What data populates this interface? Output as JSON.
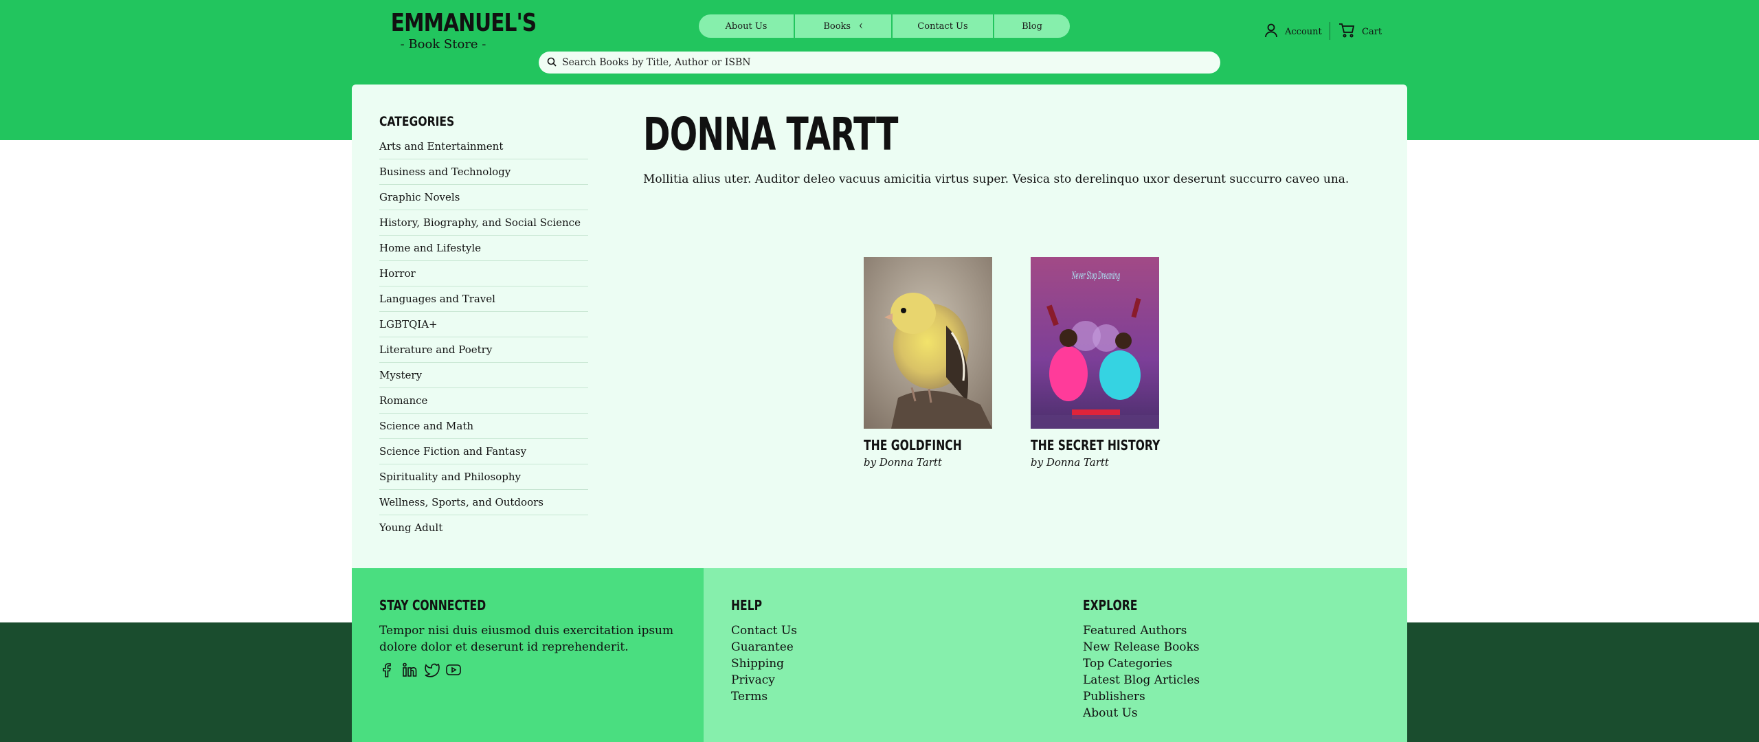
{
  "brand": {
    "name": "EMMANUEL'S",
    "tagline": "- Book Store -"
  },
  "nav": {
    "items": [
      {
        "label": "About Us"
      },
      {
        "label": "Books",
        "chevron": "chevron-left-icon"
      },
      {
        "label": "Contact Us"
      },
      {
        "label": "Blog"
      }
    ]
  },
  "header": {
    "account_label": "Account",
    "cart_label": "Cart"
  },
  "search": {
    "placeholder": "Search Books by Title, Author or ISBN"
  },
  "sidebar": {
    "title": "CATEGORIES",
    "items": [
      "Arts and Entertainment",
      "Business and Technology",
      "Graphic Novels",
      "History, Biography, and Social Science",
      "Home and Lifestyle",
      "Horror",
      "Languages and Travel",
      "LGBTQIA+",
      "Literature and Poetry",
      "Mystery",
      "Romance",
      "Science and Math",
      "Science Fiction and Fantasy",
      "Spirituality and Philosophy",
      "Wellness, Sports, and Outdoors",
      "Young Adult"
    ]
  },
  "author": {
    "name": "DONNA TARTT",
    "description": "Mollitia alius uter. Auditor deleo vacuus amicitia virtus super. Vesica sto derelinquo uxor deserunt succurro caveo una."
  },
  "books": [
    {
      "title": "THE GOLDFINCH",
      "byline": "by Donna Tartt",
      "cover": "goldfinch-bird-photo"
    },
    {
      "title": "THE SECRET HISTORY",
      "byline": "by Donna Tartt",
      "cover": "party-neon-sign-photo",
      "neon_text": "Never Stop Dreaming"
    }
  ],
  "footer": {
    "stay": {
      "title": "STAY CONNECTED",
      "text": "Tempor nisi duis eiusmod duis exercitation ipsum dolore dolor et deserunt id reprehenderit.",
      "social": [
        "facebook-icon",
        "linkedin-icon",
        "twitter-icon",
        "youtube-icon"
      ]
    },
    "help": {
      "title": "HELP",
      "links": [
        "Contact Us",
        "Guarantee",
        "Shipping",
        "Privacy",
        "Terms"
      ]
    },
    "explore": {
      "title": "EXPLORE",
      "links": [
        "Featured Authors",
        "New Release Books",
        "Top Categories",
        "Latest Blog Articles",
        "Publishers",
        "About Us"
      ]
    }
  },
  "colors": {
    "header_green": "#22c55e",
    "nav_pill": "#86efac",
    "card_bg": "#ecfdf3",
    "footer_left": "#4ade80",
    "footer_right": "#86efac",
    "footer_dark": "#1a4d2e"
  }
}
